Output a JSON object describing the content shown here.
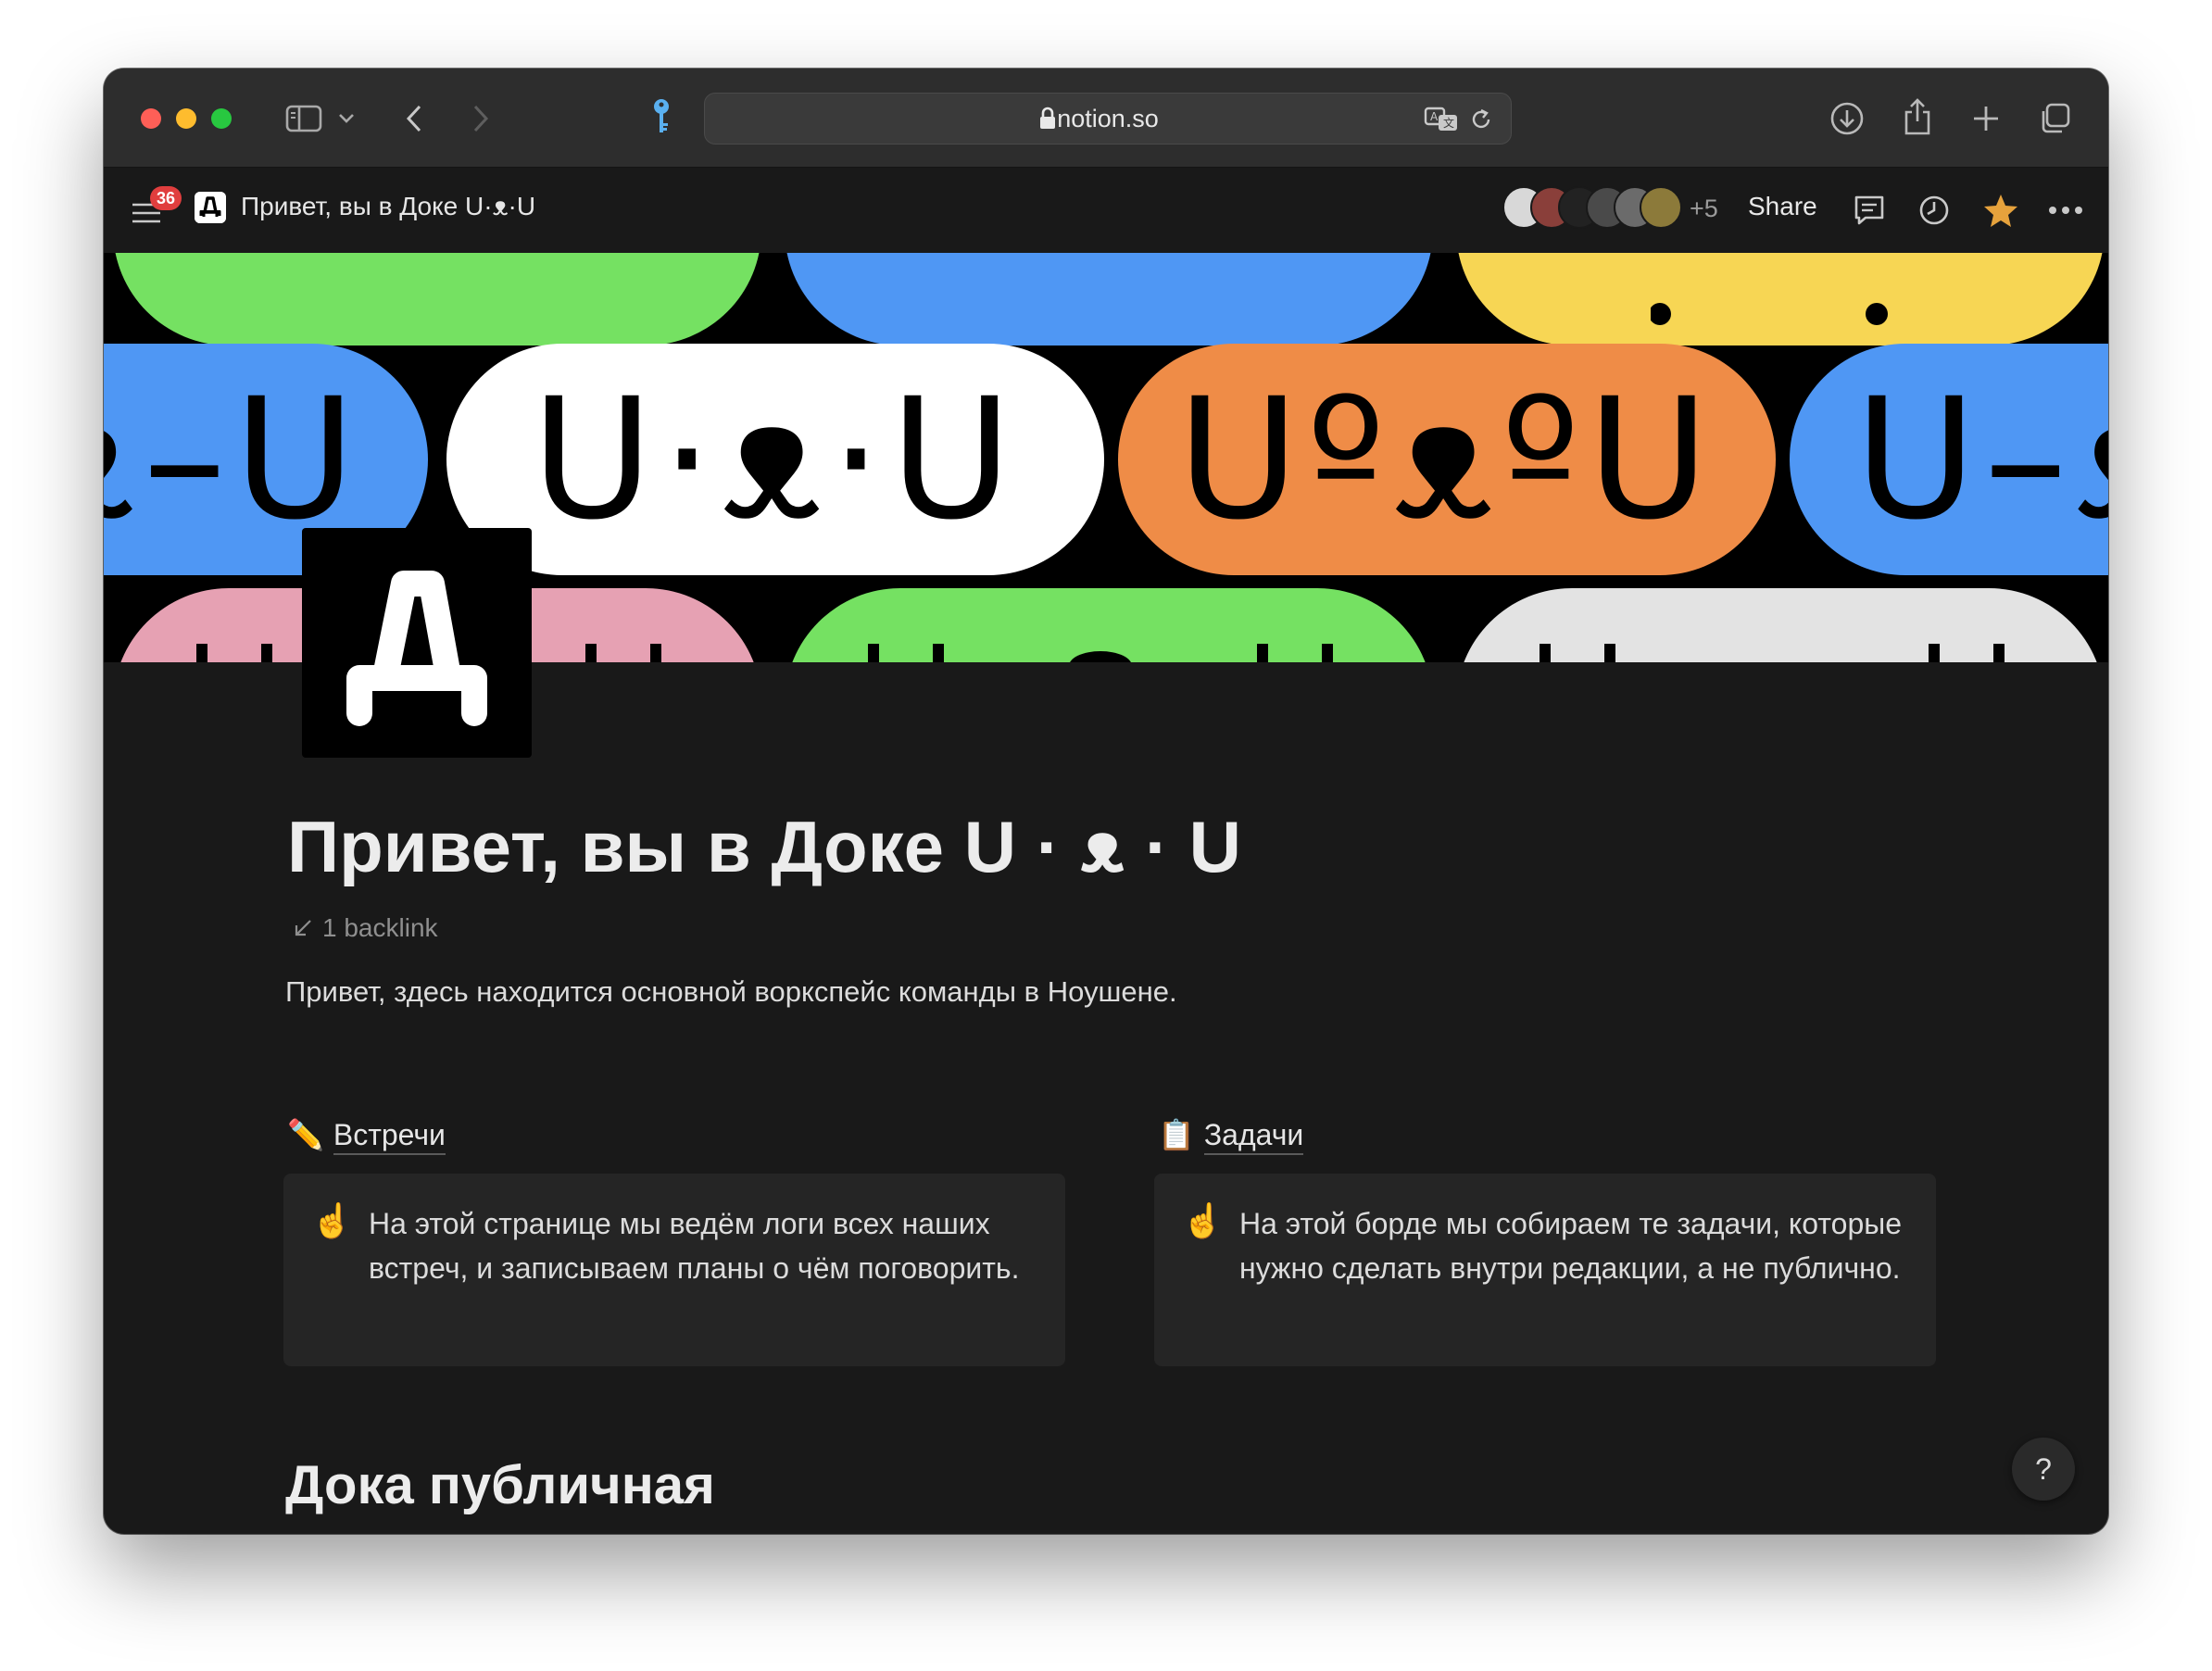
{
  "browser": {
    "url": "notion.so"
  },
  "topbar": {
    "notification_count": "36",
    "breadcrumb_title": "Привет, вы в Доке U·ᴥ·U",
    "avatars_extra": "+5",
    "share_label": "Share"
  },
  "cover": {
    "faces": [
      "U·ᴥ·U",
      "UºᴥºU",
      "U–ᴥ–U"
    ],
    "colors": [
      "#75e162",
      "#4f97f4",
      "#f7d654",
      "#ffffff",
      "#ef8c47",
      "#e6a1b3",
      "#e3e3e3"
    ]
  },
  "page": {
    "title": "Привет, вы в Доке U · ᴥ · U",
    "backlink": "1 backlink",
    "intro": "Привет, здесь находится основной воркспейс команды в Ноушене.",
    "columns": [
      {
        "icon": "✏️",
        "heading": "Встречи",
        "callout_icon": "☝️",
        "callout_text": "На этой странице мы ведём логи всех наших встреч, и записываем планы о чём поговорить."
      },
      {
        "icon": "📋",
        "heading": "Задачи",
        "callout_icon": "☝️",
        "callout_text": "На этой борде мы собираем те задачи, которые нужно сделать внутри редакции, а не публично."
      }
    ],
    "section_heading": "Дока публичная"
  },
  "help": {
    "label": "?"
  }
}
